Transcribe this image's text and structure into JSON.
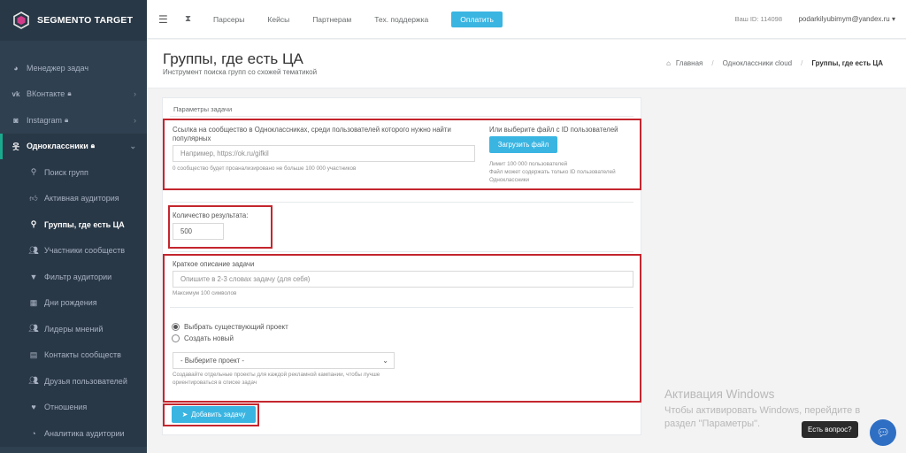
{
  "brand": {
    "name": "SEGMENTO TARGET"
  },
  "sidebar": {
    "items": [
      {
        "label": "Менеджер задач",
        "icon": "dashboard-icon"
      },
      {
        "label": "ВКонтакте",
        "icon": "vk-icon",
        "locked": true
      },
      {
        "label": "Instagram",
        "icon": "instagram-icon",
        "locked": true
      },
      {
        "label": "Одноклассники",
        "icon": "odnoklassniki-icon",
        "locked": true
      }
    ],
    "subitems": [
      {
        "label": "Поиск групп",
        "icon": "search-icon"
      },
      {
        "label": "Активная аудитория",
        "icon": "thumbs-up-icon"
      },
      {
        "label": "Группы, где есть ЦА",
        "icon": "search-icon"
      },
      {
        "label": "Участники сообществ",
        "icon": "users-icon"
      },
      {
        "label": "Фильтр аудитории",
        "icon": "filter-icon"
      },
      {
        "label": "Дни рождения",
        "icon": "calendar-icon"
      },
      {
        "label": "Лидеры мнений",
        "icon": "users-icon"
      },
      {
        "label": "Контакты сообществ",
        "icon": "contacts-icon"
      },
      {
        "label": "Друзья пользователей",
        "icon": "users-icon"
      },
      {
        "label": "Отношения",
        "icon": "heart-icon"
      },
      {
        "label": "Аналитика аудитории",
        "icon": "pie-chart-icon"
      }
    ]
  },
  "topbar": {
    "links": [
      "Парсеры",
      "Кейсы",
      "Партнерам",
      "Тех. поддержка"
    ],
    "pay_label": "Оплатить",
    "user_id": "Ваш ID: 114098",
    "user_email": "podarkilyubimym@yandex.ru"
  },
  "page": {
    "title": "Группы, где есть ЦА",
    "subtitle": "Инструмент поиска групп со схожей тематикой",
    "breadcrumbs": [
      "Главная",
      "Одноклассники cloud",
      "Группы, где есть ЦА"
    ]
  },
  "form": {
    "section_title": "Параметры задачи",
    "link_label": "Ссылка на сообщество в Одноклассниках, среди пользователей которого нужно найти популярных",
    "link_placeholder": "Например, https://ok.ru/gifkil",
    "link_help": "0 сообщество будет проанализировано не больше 100 000 участников",
    "file_label": "Или выберите файл с ID пользователей",
    "upload_label": "Загрузить файл",
    "file_help_1": "Лимит 100 000 пользователей",
    "file_help_2": "Файл может содержать только ID пользователей Одноклассники",
    "count_label": "Количество результата:",
    "count_value": "500",
    "desc_label": "Краткое описание задачи",
    "desc_placeholder": "Опишите в 2-3 словах задачу (для себя)",
    "desc_help": "Максимум 100 символов",
    "radio_existing": "Выбрать существующий проект",
    "radio_new": "Создать новый",
    "project_select": "- Выберите проект -",
    "project_help": "Создавайте отдельные проекты для каждой рекламной кампании, чтобы лучше ориентироваться в списке задач",
    "submit_label": "Добавить задачу"
  },
  "watermark": {
    "title": "Активация Windows",
    "text": "Чтобы активировать Windows, перейдите в раздел \"Параметры\"."
  },
  "chat": {
    "tooltip": "Есть вопрос?"
  },
  "colors": {
    "sidebar": "#2f4050",
    "accent": "#3ab5e2",
    "highlight_border": "#c4262e"
  }
}
